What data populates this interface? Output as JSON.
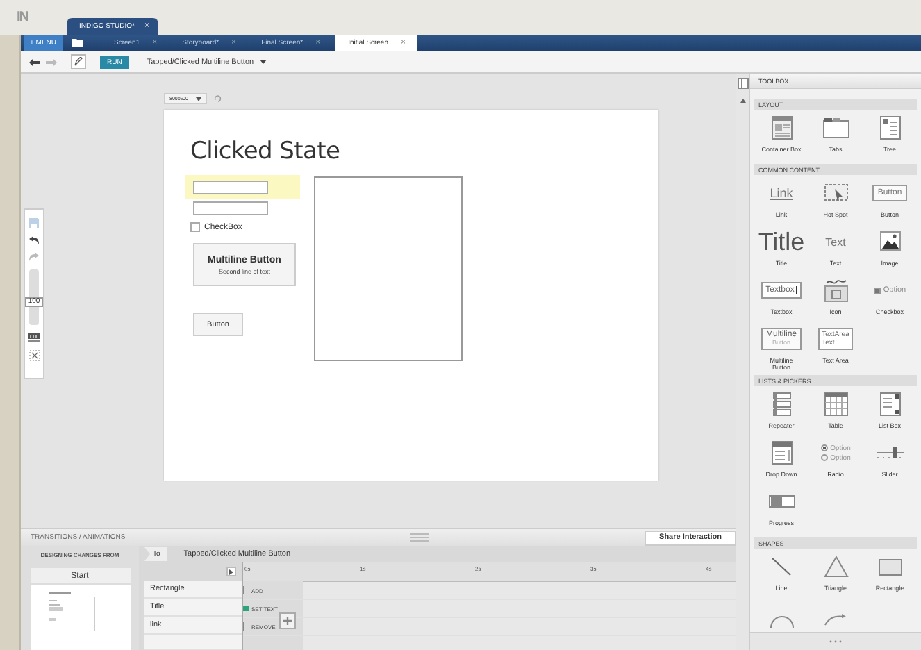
{
  "app": {
    "logo": "IN",
    "title_tab": "INDIGO STUDIO*",
    "title_close": "×"
  },
  "menu_button": "+ MENU",
  "document_tabs": [
    {
      "label": "Screen1",
      "close": "×",
      "selected": false
    },
    {
      "label": "Storyboard*",
      "close": "×",
      "selected": false
    },
    {
      "label": "Final Screen*",
      "close": "×",
      "selected": false
    },
    {
      "label": "Initial Screen",
      "close": "×",
      "selected": true
    }
  ],
  "toolbar": {
    "run": "RUN",
    "interaction": "Tapped/Clicked Multiline Button"
  },
  "canvas": {
    "size": "800x600",
    "zoom": {
      "reading": "100",
      "level": 0.4
    },
    "artboard": {
      "title": "Clicked State",
      "fields": [
        {
          "highlighted": true
        },
        {
          "highlighted": false
        }
      ],
      "checkbox": {
        "label": "CheckBox",
        "checked": false
      },
      "multiline_button": {
        "line1": "Multiline Button",
        "line2": "Second line of text"
      },
      "button": "Button"
    }
  },
  "toolbox": {
    "title": "TOOLBOX",
    "sections": [
      {
        "title": "LAYOUT",
        "items": [
          {
            "kind": "container",
            "label": "Container Box"
          },
          {
            "kind": "tabs",
            "label": "Tabs"
          },
          {
            "kind": "tree",
            "label": "Tree"
          }
        ]
      },
      {
        "title": "COMMON CONTENT",
        "items": [
          {
            "kind": "link",
            "label": "Link",
            "preview": [
              "Link"
            ]
          },
          {
            "kind": "hotspot",
            "label": "Hot Spot"
          },
          {
            "kind": "button",
            "label": "Button",
            "preview": [
              "Button"
            ]
          },
          {
            "kind": "title",
            "label": "Title",
            "preview": [
              "Title"
            ]
          },
          {
            "kind": "text",
            "label": "Text",
            "preview": [
              "Text"
            ]
          },
          {
            "kind": "image",
            "label": "Image"
          },
          {
            "kind": "textbox",
            "label": "Textbox",
            "preview": [
              "Textbox"
            ]
          },
          {
            "kind": "icon",
            "label": "Icon"
          },
          {
            "kind": "checkbox",
            "label": "Checkbox",
            "preview": [
              "Option"
            ],
            "checked": true
          },
          {
            "kind": "multiline",
            "label": "Multiline Button",
            "preview": [
              "Multiline",
              "Button"
            ]
          },
          {
            "kind": "textarea",
            "label": "Text Area",
            "preview": [
              "TextArea",
              "Text..."
            ]
          }
        ]
      },
      {
        "title": "LISTS & PICKERS",
        "items": [
          {
            "kind": "repeater",
            "label": "Repeater"
          },
          {
            "kind": "table",
            "label": "Table"
          },
          {
            "kind": "listbox",
            "label": "List Box"
          },
          {
            "kind": "dropdown",
            "label": "Drop Down"
          },
          {
            "kind": "radio",
            "label": "Radio",
            "preview": [
              "Option",
              "Option"
            ]
          },
          {
            "kind": "slider",
            "label": "Slider"
          },
          {
            "kind": "progress",
            "label": "Progress"
          }
        ]
      },
      {
        "title": "SHAPES",
        "items": [
          {
            "kind": "line",
            "label": "Line"
          },
          {
            "kind": "triangle",
            "label": "Triangle"
          },
          {
            "kind": "rectangle",
            "label": "Rectangle"
          },
          {
            "kind": "arc"
          },
          {
            "kind": "curve"
          }
        ]
      }
    ]
  },
  "transitions": {
    "title": "TRANSITIONS / ANIMATIONS",
    "share": "Share Interaction",
    "from_label": "DESIGNING CHANGES FROM",
    "start": "Start",
    "to": "To",
    "target": "Tapped/Clicked Multiline Button",
    "ticks": [
      "0s",
      "1s",
      "2s",
      "3s",
      "4s"
    ],
    "layers": [
      {
        "name": "Rectangle",
        "action": "ADD",
        "kind": "add"
      },
      {
        "name": "Title",
        "action": "SET TEXT",
        "kind": "set"
      },
      {
        "name": "link",
        "action": "REMOVE",
        "kind": "remove"
      }
    ]
  }
}
